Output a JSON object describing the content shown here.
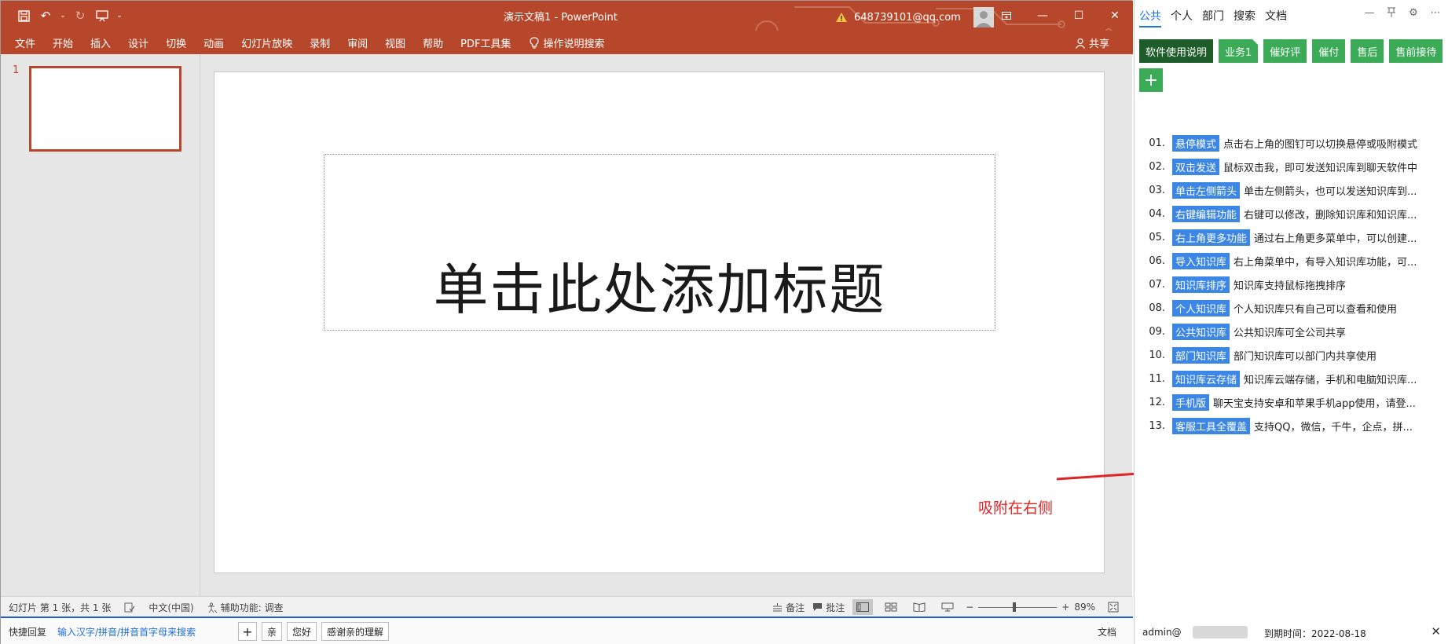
{
  "ppt": {
    "doc_title": "演示文稿1  -  PowerPoint",
    "account": "648739101@qq.com",
    "ribbon_tabs": [
      "文件",
      "开始",
      "插入",
      "设计",
      "切换",
      "动画",
      "幻灯片放映",
      "录制",
      "审阅",
      "视图",
      "帮助",
      "PDF工具集"
    ],
    "tell_me": "操作说明搜索",
    "share": "共享",
    "slide_number": "1",
    "title_placeholder": "单击此处添加标题",
    "annotation": "吸附在右侧",
    "status": {
      "slide_info": "幻灯片 第 1 张，共 1 张",
      "language": "中文(中国)",
      "accessibility": "辅助功能: 调查",
      "notes": "备注",
      "comments": "批注",
      "zoom": "89%"
    },
    "quickbar": {
      "label": "快捷回复",
      "input_hint": "输入汉字/拼音/拼音首字母来搜索",
      "buttons": [
        "亲",
        "您好",
        "感谢亲的理解"
      ],
      "doc": "文档"
    }
  },
  "panel": {
    "tabs": [
      "公共",
      "个人",
      "部门",
      "搜索",
      "文档"
    ],
    "categories": [
      "软件使用说明",
      "业务1",
      "催好评",
      "催付",
      "售后",
      "售前接待"
    ],
    "items": [
      {
        "num": "01.",
        "tag": "悬停模式",
        "desc": "点击右上角的图钉可以切换悬停或吸附模式"
      },
      {
        "num": "02.",
        "tag": "双击发送",
        "desc": "鼠标双击我，即可发送知识库到聊天软件中"
      },
      {
        "num": "03.",
        "tag": "单击左侧箭头",
        "desc": "单击左侧箭头，也可以发送知识库到..."
      },
      {
        "num": "04.",
        "tag": "右键编辑功能",
        "desc": "右键可以修改，删除知识库和知识库..."
      },
      {
        "num": "05.",
        "tag": "右上角更多功能",
        "desc": "通过右上角更多菜单中，可以创建..."
      },
      {
        "num": "06.",
        "tag": "导入知识库",
        "desc": "右上角菜单中，有导入知识库功能，可..."
      },
      {
        "num": "07.",
        "tag": "知识库排序",
        "desc": "知识库支持鼠标拖拽排序"
      },
      {
        "num": "08.",
        "tag": "个人知识库",
        "desc": "个人知识库只有自己可以查看和使用"
      },
      {
        "num": "09.",
        "tag": "公共知识库",
        "desc": "公共知识库可全公司共享"
      },
      {
        "num": "10.",
        "tag": "部门知识库",
        "desc": "部门知识库可以部门内共享使用"
      },
      {
        "num": "11.",
        "tag": "知识库云存储",
        "desc": "知识库云端存储，手机和电脑知识库..."
      },
      {
        "num": "12.",
        "tag": "手机版",
        "desc": "聊天宝支持安卓和苹果手机app使用，请登..."
      },
      {
        "num": "13.",
        "tag": "客服工具全覆盖",
        "desc": "支持QQ，微信，千牛，企点，拼..."
      }
    ],
    "footer": {
      "user": "admin@",
      "expiry": "到期时间：2022-08-18"
    }
  }
}
